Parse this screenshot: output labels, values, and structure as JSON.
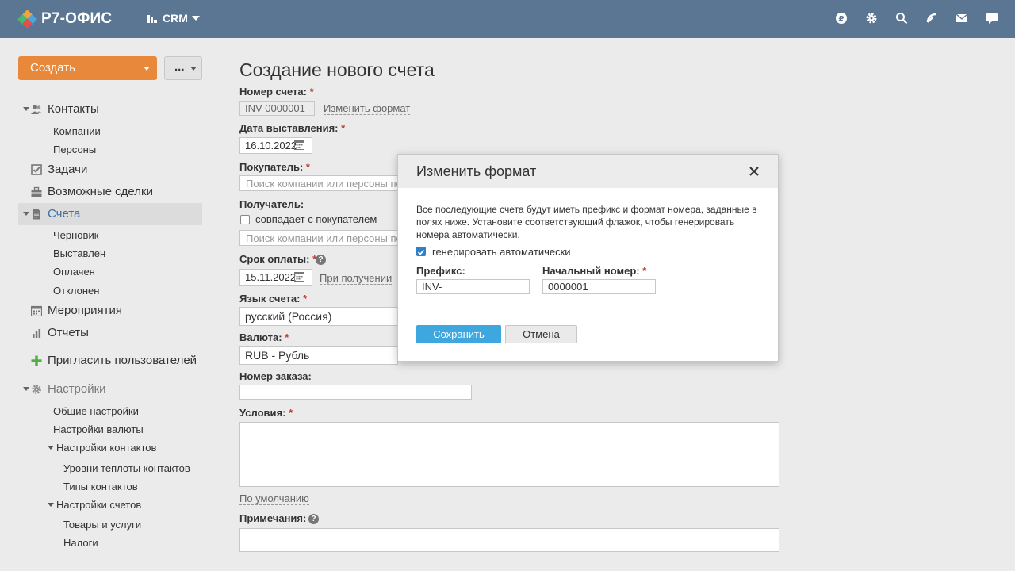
{
  "header": {
    "logo_text": "Р7-ОФИС",
    "module_label": "CRM",
    "icons": [
      "ruble-icon",
      "settings-gear-icon",
      "search-icon",
      "feed-icon",
      "mail-icon",
      "chat-icon"
    ]
  },
  "sidebar": {
    "create_label": "Создать",
    "more_label": "...",
    "contacts": "Контакты",
    "contacts_sub": [
      "Компании",
      "Персоны"
    ],
    "tasks": "Задачи",
    "deals": "Возможные сделки",
    "invoices": "Счета",
    "invoices_sub": [
      "Черновик",
      "Выставлен",
      "Оплачен",
      "Отклонен"
    ],
    "events": "Мероприятия",
    "reports": "Отчеты",
    "invite": "Пригласить пользователей",
    "settings": "Настройки",
    "settings_sub": {
      "general": "Общие настройки",
      "currency": "Настройки валюты",
      "contacts": "Настройки контактов",
      "contact_levels": "Уровни теплоты контактов",
      "contact_types": "Типы контактов",
      "invoices": "Настройки счетов",
      "products": "Товары и услуги",
      "taxes": "Налоги"
    }
  },
  "form": {
    "title": "Создание нового счета",
    "invoice_number_label": "Номер счета:",
    "invoice_number_value": "INV-0000001",
    "change_format_link": "Изменить формат",
    "issue_date_label": "Дата выставления:",
    "issue_date_value": "16.10.2022",
    "buyer_label": "Покупатель:",
    "buyer_placeholder": "Поиск компании или персоны по",
    "recipient_label": "Получатель:",
    "same_as_buyer": "совпадает с покупателем",
    "recipient_placeholder": "Поиск компании или персоны по",
    "due_label": "Срок оплаты:",
    "due_value": "15.11.2022",
    "on_receipt_link": "При получении",
    "lang_label": "Язык счета:",
    "lang_value": "русский (Россия)",
    "currency_label": "Валюта:",
    "currency_value": "RUB - Рубль",
    "order_label": "Номер заказа:",
    "terms_label": "Условия:",
    "default_link": "По умолчанию",
    "notes_label": "Примечания:",
    "required_mark": "*",
    "help_mark": "?"
  },
  "dialog": {
    "title": "Изменить формат",
    "description": "Все последующие счета будут иметь префикс и формат номера, заданные в полях ниже. Установите соответствующий флажок, чтобы генерировать номера автоматически.",
    "auto_generate_label": "генерировать автоматически",
    "auto_generate_checked": true,
    "prefix_label": "Префикс:",
    "prefix_value": "INV-",
    "start_number_label": "Начальный номер:",
    "start_number_value": "0000001",
    "save_label": "Сохранить",
    "cancel_label": "Отмена"
  },
  "colors": {
    "header_bg": "#5b7693",
    "create_button": "#e8883a",
    "save_button": "#3fa7df",
    "active_nav_text": "#3b6fa5",
    "required": "#c0392b"
  }
}
